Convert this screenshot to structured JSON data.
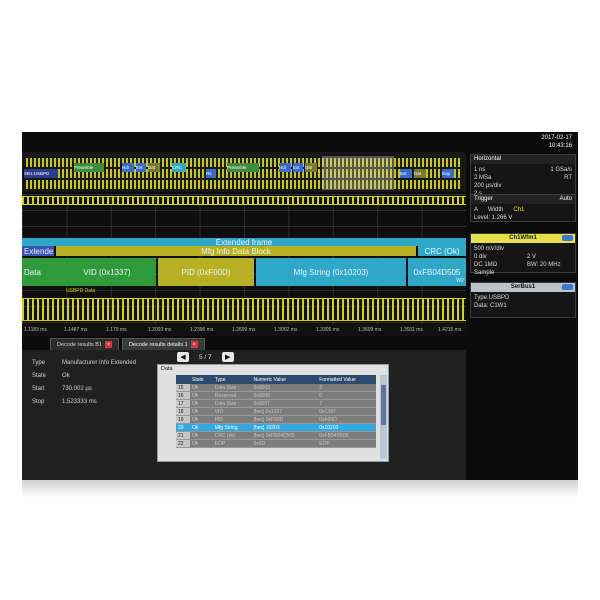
{
  "datetime": {
    "date": "2017-02-17",
    "time": "10:43:16"
  },
  "overview": {
    "left_label": "SB1:USBPD",
    "segments": [
      "Preamble",
      "Hdr",
      "Ext",
      "Dat",
      "CRC",
      "Rx",
      "Preamble",
      "Hdr",
      "Ext",
      "Dat",
      "Ext",
      "Dat",
      "Eop"
    ]
  },
  "decode": {
    "top_label": "Extended frame",
    "mid_label": "Mfg Info Data Block",
    "left_tag1": "Extende",
    "right_tag": "CRC (Ok)",
    "left_tag2": "Data",
    "fields": [
      "VID (0x1337)",
      "PID (0xF00D)",
      "Mfg String (0x10203)",
      "0xFB04D505"
    ],
    "lane_label": "USBPD Data",
    "ref_marker": "W2"
  },
  "time_ticks": [
    "1.1183 ms",
    "1.1487 ms",
    "1.179 ms",
    "1.2093 ms",
    "1.2396 ms",
    "1.2699 ms",
    "1.3002 ms",
    "1.3305 ms",
    "1.3609 ms",
    "1.3911 ms",
    "1.4215 ms"
  ],
  "tabs": [
    {
      "label": "Decode results B1",
      "active": false
    },
    {
      "label": "Decode results details 1",
      "active": true
    }
  ],
  "tab_close_glyph": "×",
  "details": {
    "type_label": "Type",
    "type_value": "Manufacturer Info Extended",
    "state_label": "State",
    "state_value": "Ok",
    "start_label": "Start",
    "start_value": "730.002 µs",
    "stop_label": "Stop",
    "stop_value": "1.523333 ms"
  },
  "pager": {
    "text": "5 / 7",
    "prev": "◀",
    "next": "▶"
  },
  "table": {
    "label": "Data",
    "headers": [
      "",
      "State",
      "Type",
      "Numeric Value",
      "Formatted Value"
    ],
    "rows": [
      [
        "15",
        "Ok",
        "Data Size",
        "0x0003",
        "3"
      ],
      [
        "16",
        "Ok",
        "Reserved",
        "0x0000",
        "0"
      ],
      [
        "17",
        "Ok",
        "Data Size",
        "0x0007",
        "7"
      ],
      [
        "18",
        "Ok",
        "VID",
        "[hex] 0x1337",
        "0x1337"
      ],
      [
        "19",
        "Ok",
        "PID",
        "[hex] 0xF00D",
        "0xF00D"
      ],
      [
        "20",
        "Ok",
        "Mfg String",
        "[hex] 10203",
        "0x10203"
      ],
      [
        "21",
        "Ok",
        "CRC (ok)",
        "[hex] 0xFB04D505",
        "0xFB04D505"
      ],
      [
        "22",
        "Ok",
        "EOP",
        "0x0D",
        "EOP"
      ]
    ],
    "selected_row": 5
  },
  "horizontal": {
    "title": "Horizontal",
    "l1": "1 ns",
    "r1": "1 GSa/s",
    "l2": "2 MSa",
    "r2": "RT",
    "l3": "200 µs/div",
    "l4": "2 s"
  },
  "trigger": {
    "title": "Trigger",
    "mode": "Auto",
    "l1": "A",
    "m1": "Width",
    "r1": "Ch1",
    "l2": "Level: 1.266 V"
  },
  "channel": {
    "title": "Ch1Wfm1",
    "l1": "500 mV/div",
    "l2": "0 div",
    "r2": "2 V",
    "l3": "DC 1MΩ",
    "r3": "BW: 20 MHz",
    "l4": "Sample"
  },
  "serbus": {
    "title": "SerBus1",
    "l1": "Type:USBPD",
    "l2": "Data: C1W1"
  },
  "colors": {
    "waveform": "#d8d400",
    "decode_cyan": "#2fa8c8",
    "decode_yellow": "#b7b023",
    "decode_green": "#2f9a3a",
    "screen_bg": "#0b0b0b"
  }
}
